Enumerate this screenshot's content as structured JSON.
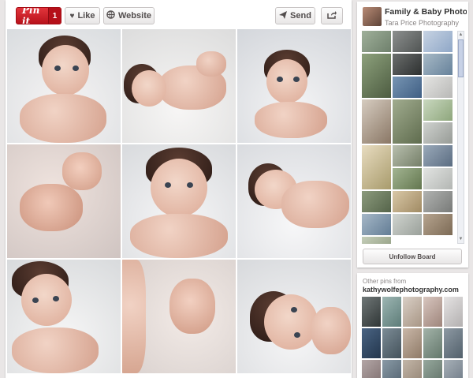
{
  "toolbar": {
    "pinit_label": "Pin it",
    "pinit_count": "1",
    "like_label": "Like",
    "website_label": "Website",
    "send_label": "Send"
  },
  "board": {
    "title": "Family & Baby Photography",
    "owner": "Tara Price Photography",
    "unfollow_label": "Unfollow Board"
  },
  "other_pins": {
    "label": "Other pins from",
    "source": "kathywolfephotography.com"
  },
  "colors": {
    "pinit_red": "#cb2027",
    "background": "#e9e6e6"
  }
}
